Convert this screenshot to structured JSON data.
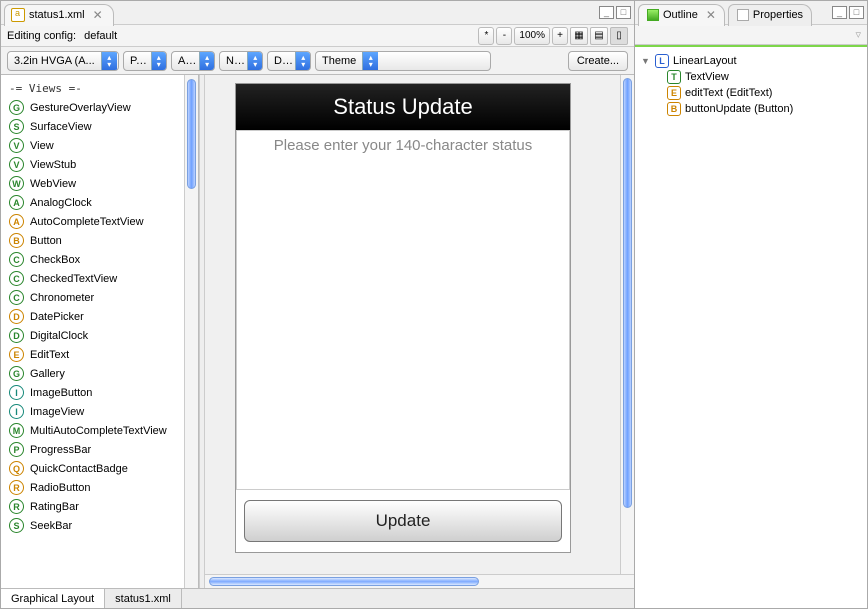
{
  "editorTab": {
    "filename": "status1.xml"
  },
  "configRow": {
    "label": "Editing config:",
    "value": "default",
    "zoom": "100%"
  },
  "toolbar": {
    "device": "3.2in HVGA (A...",
    "d1": "P...",
    "d2": "A...",
    "d3": "N...",
    "d4": "D...",
    "theme": "Theme",
    "create": "Create..."
  },
  "palette": {
    "header": "-= Views =-",
    "items": [
      {
        "letter": "G",
        "cls": "b-green",
        "label": "GestureOverlayView"
      },
      {
        "letter": "S",
        "cls": "b-green",
        "label": "SurfaceView"
      },
      {
        "letter": "V",
        "cls": "b-green",
        "label": "View"
      },
      {
        "letter": "V",
        "cls": "b-green",
        "label": "ViewStub"
      },
      {
        "letter": "W",
        "cls": "b-green",
        "label": "WebView"
      },
      {
        "letter": "A",
        "cls": "b-green",
        "label": "AnalogClock"
      },
      {
        "letter": "A",
        "cls": "b-orange",
        "label": "AutoCompleteTextView"
      },
      {
        "letter": "B",
        "cls": "b-orange",
        "label": "Button"
      },
      {
        "letter": "C",
        "cls": "b-green",
        "label": "CheckBox"
      },
      {
        "letter": "C",
        "cls": "b-green",
        "label": "CheckedTextView"
      },
      {
        "letter": "C",
        "cls": "b-green",
        "label": "Chronometer"
      },
      {
        "letter": "D",
        "cls": "b-orange",
        "label": "DatePicker"
      },
      {
        "letter": "D",
        "cls": "b-green",
        "label": "DigitalClock"
      },
      {
        "letter": "E",
        "cls": "b-orange",
        "label": "EditText"
      },
      {
        "letter": "G",
        "cls": "b-green",
        "label": "Gallery"
      },
      {
        "letter": "I",
        "cls": "b-teal",
        "label": "ImageButton"
      },
      {
        "letter": "I",
        "cls": "b-teal",
        "label": "ImageView"
      },
      {
        "letter": "M",
        "cls": "b-green",
        "label": "MultiAutoCompleteTextView"
      },
      {
        "letter": "P",
        "cls": "b-green",
        "label": "ProgressBar"
      },
      {
        "letter": "Q",
        "cls": "b-orange",
        "label": "QuickContactBadge"
      },
      {
        "letter": "R",
        "cls": "b-orange",
        "label": "RadioButton"
      },
      {
        "letter": "R",
        "cls": "b-green",
        "label": "RatingBar"
      },
      {
        "letter": "S",
        "cls": "b-green",
        "label": "SeekBar"
      }
    ]
  },
  "device": {
    "title": "Status Update",
    "hint": "Please enter your 140-character status",
    "button": "Update"
  },
  "bottomTabs": {
    "graphical": "Graphical Layout",
    "source": "status1.xml"
  },
  "rightPane": {
    "outlineTab": "Outline",
    "propertiesTab": "Properties",
    "tree": {
      "root": "LinearLayout",
      "n1": "TextView",
      "n2": "editText (EditText)",
      "n3": "buttonUpdate (Button)"
    }
  }
}
